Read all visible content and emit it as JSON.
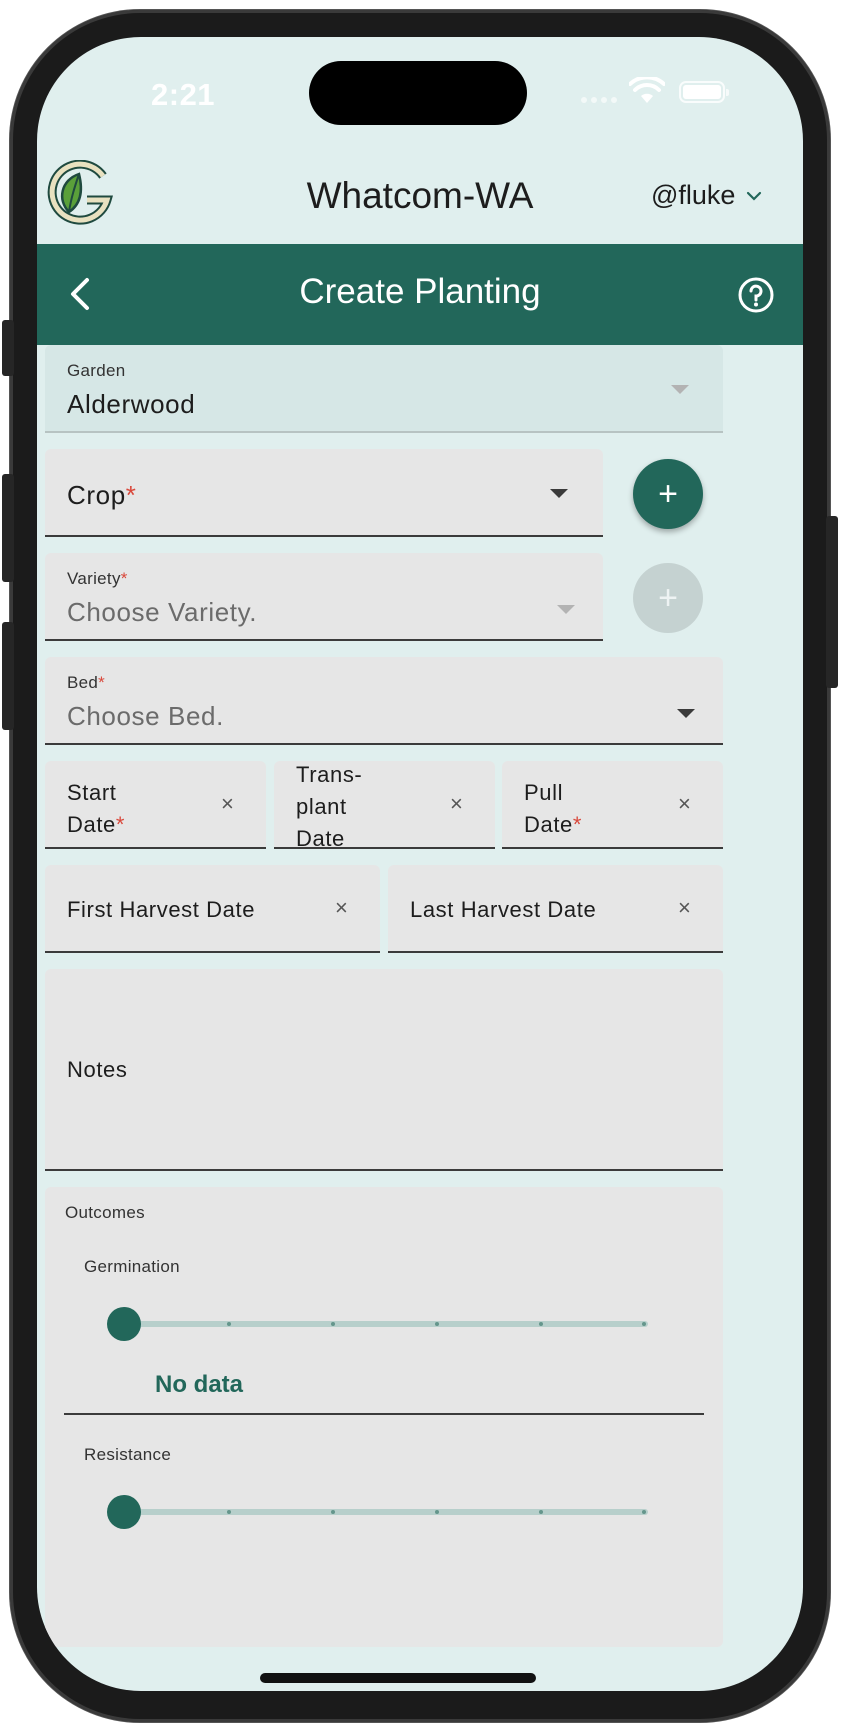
{
  "status_bar": {
    "time": "2:21"
  },
  "header": {
    "org_title": "Whatcom-WA",
    "user": "@fluke"
  },
  "appbar": {
    "title": "Create Planting"
  },
  "form": {
    "garden": {
      "label": "Garden",
      "value": "Alderwood"
    },
    "crop": {
      "label": "Crop",
      "required": "*"
    },
    "variety": {
      "label": "Variety",
      "required": "*",
      "placeholder": "Choose Variety."
    },
    "bed": {
      "label": "Bed",
      "required": "*",
      "placeholder": "Choose Bed."
    },
    "start_date": {
      "line1": "Start",
      "line2": "Date",
      "required": "*"
    },
    "transplant_date": {
      "line1": "Trans-",
      "line2": "plant",
      "line3": "Date"
    },
    "pull_date": {
      "line1": "Pull",
      "line2": "Date",
      "required": "*"
    },
    "first_harvest": {
      "label": "First Harvest Date"
    },
    "last_harvest": {
      "label": "Last Harvest Date"
    },
    "notes": {
      "label": "Notes"
    },
    "clear_glyph": "×",
    "add_glyph": "+"
  },
  "outcomes": {
    "label": "Outcomes",
    "germination": {
      "label": "Germination",
      "value_text": "No data",
      "level": 0
    },
    "resistance": {
      "label": "Resistance",
      "level": 0
    }
  },
  "colors": {
    "brand": "#22675a",
    "background": "#e0efee",
    "required": "#d9483b"
  }
}
